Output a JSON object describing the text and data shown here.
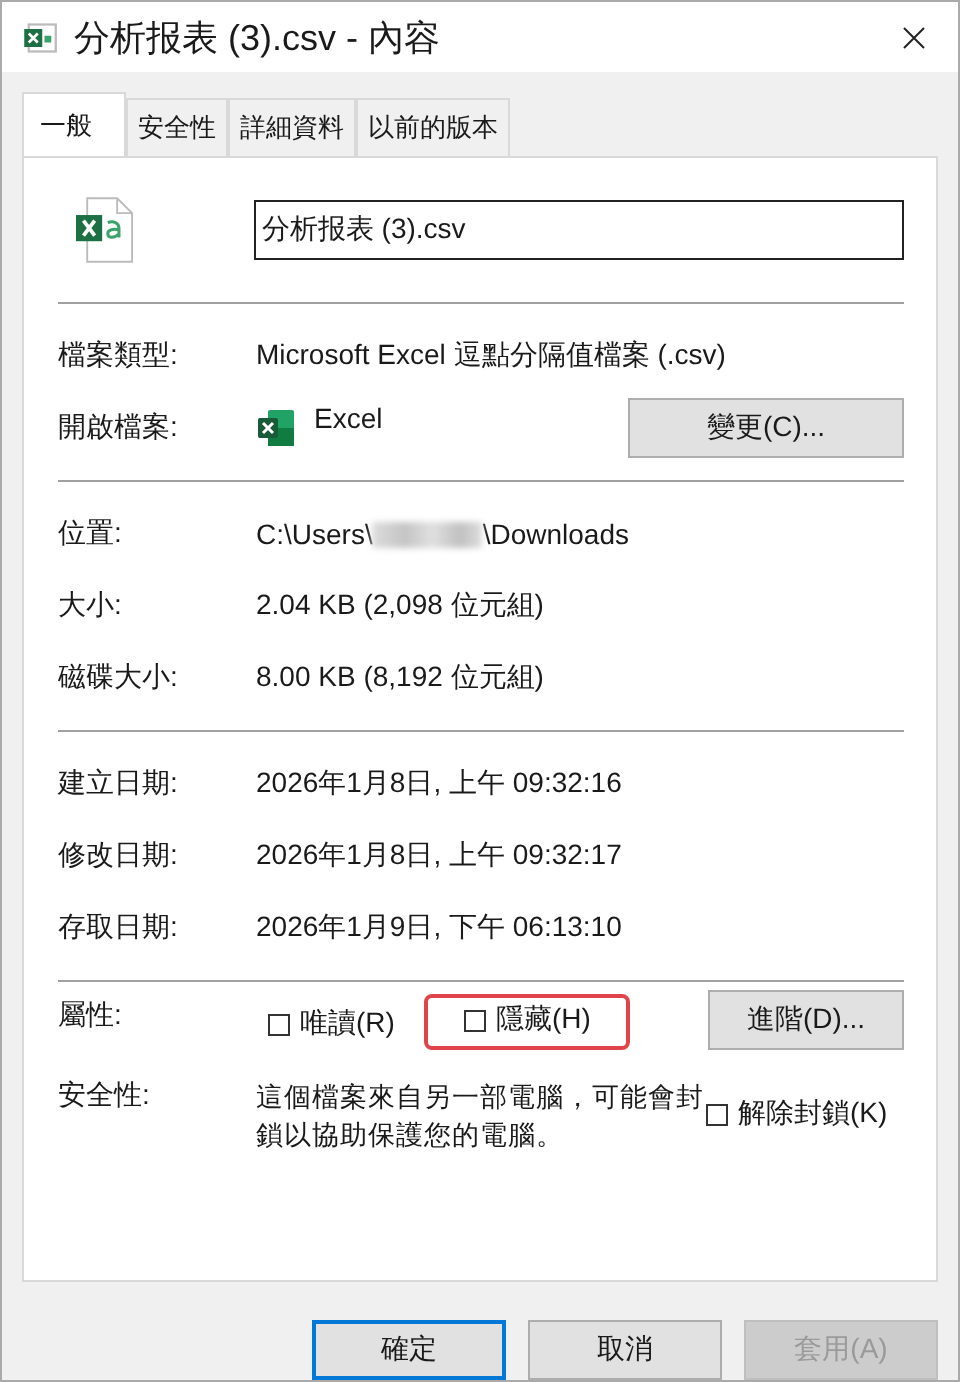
{
  "window": {
    "title": "分析报表 (3).csv - 內容"
  },
  "tabs": [
    {
      "label": "一般",
      "selected": true
    },
    {
      "label": "安全性",
      "selected": false
    },
    {
      "label": "詳細資料",
      "selected": false
    },
    {
      "label": "以前的版本",
      "selected": false
    }
  ],
  "file_name": "分析报表 (3).csv",
  "sections": [
    [
      {
        "kind": "text",
        "label": "檔案類型:",
        "value": "Microsoft Excel 逗點分隔值檔案 (.csv)"
      },
      {
        "kind": "app",
        "label": "開啟檔案:",
        "value": "Excel",
        "button": "變更(C)..."
      }
    ],
    [
      {
        "kind": "path",
        "label": "位置:",
        "prefix": "C:\\Users\\",
        "suffix": "\\Downloads",
        "redacted": true
      },
      {
        "kind": "text",
        "label": "大小:",
        "value": "2.04 KB (2,098 位元組)"
      },
      {
        "kind": "text",
        "label": "磁碟大小:",
        "value": "8.00 KB (8,192 位元組)"
      }
    ],
    [
      {
        "kind": "text",
        "label": "建立日期:",
        "value": "2026年1月8日, 上午 09:32:16"
      },
      {
        "kind": "text",
        "label": "修改日期:",
        "value": "2026年1月8日, 上午 09:32:17"
      },
      {
        "kind": "text",
        "label": "存取日期:",
        "value": "2026年1月9日, 下午 06:13:10"
      }
    ]
  ],
  "attributes": {
    "label": "屬性:",
    "checkboxes": [
      {
        "label": "唯讀(R)",
        "checked": false,
        "highlighted": false
      },
      {
        "label": "隱藏(H)",
        "checked": false,
        "highlighted": true
      }
    ],
    "button": "進階(D)..."
  },
  "security": {
    "label": "安全性:",
    "text": "這個檔案來自另一部電腦，可能會封鎖以協助保護您的電腦。",
    "checkbox": {
      "label": "解除封鎖(K)",
      "checked": false
    }
  },
  "buttons": [
    {
      "label": "確定",
      "default": true,
      "disabled": false
    },
    {
      "label": "取消",
      "default": false,
      "disabled": false
    },
    {
      "label": "套用(A)",
      "default": false,
      "disabled": true
    }
  ]
}
